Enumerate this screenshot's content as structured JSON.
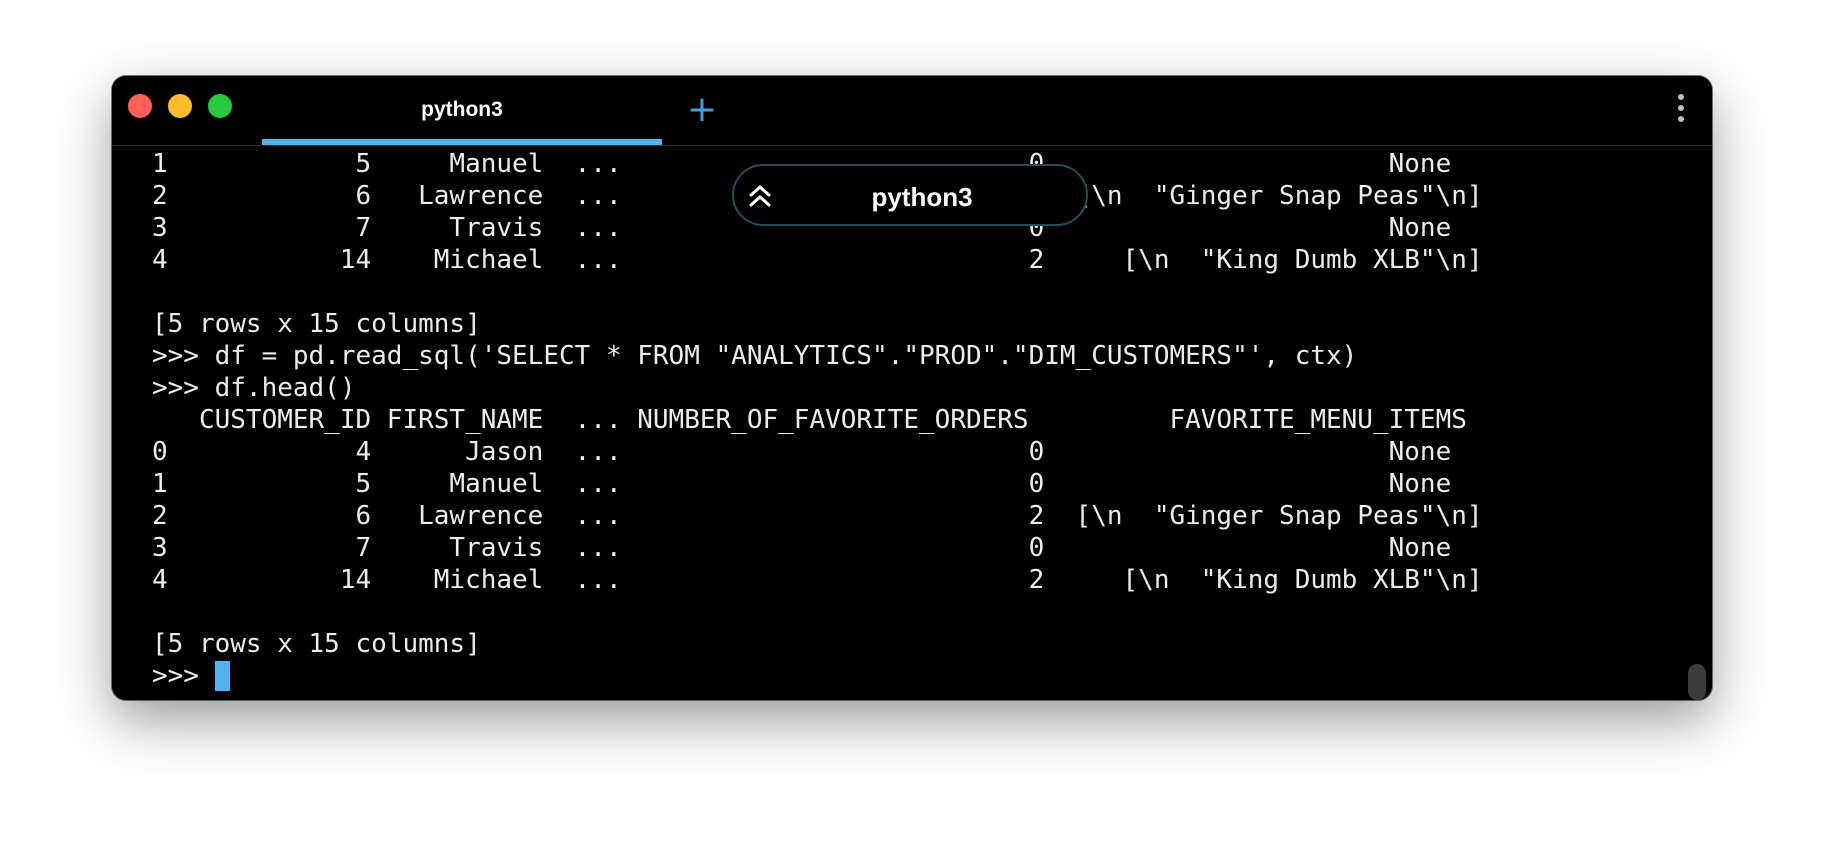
{
  "window": {
    "tab": {
      "label": "python3"
    },
    "new_tab_label": "+",
    "overlay": {
      "label": "python3"
    }
  },
  "terminal": {
    "lines": [
      "1            5     Manuel  ...                          0                      None",
      "2            6   Lawrence  ...                          2  [\\n  \"Ginger Snap Peas\"\\n]",
      "3            7     Travis  ...                          0                      None",
      "4           14    Michael  ...                          2     [\\n  \"King Dumb XLB\"\\n]",
      "",
      "[5 rows x 15 columns]",
      ">>> df = pd.read_sql('SELECT * FROM \"ANALYTICS\".\"PROD\".\"DIM_CUSTOMERS\"', ctx)",
      ">>> df.head()",
      "   CUSTOMER_ID FIRST_NAME  ... NUMBER_OF_FAVORITE_ORDERS         FAVORITE_MENU_ITEMS",
      "0            4      Jason  ...                          0                      None",
      "1            5     Manuel  ...                          0                      None",
      "2            6   Lawrence  ...                          2  [\\n  \"Ginger Snap Peas\"\\n]",
      "3            7     Travis  ...                          0                      None",
      "4           14    Michael  ...                          2     [\\n  \"King Dumb XLB\"\\n]",
      "",
      "[5 rows x 15 columns]"
    ],
    "prompt": ">>> "
  },
  "colors": {
    "background": "#000000",
    "text": "#ececec",
    "accent": "#4fb3ec",
    "close": "#fe5f57",
    "minimize": "#febc2e",
    "zoom": "#28c840"
  }
}
